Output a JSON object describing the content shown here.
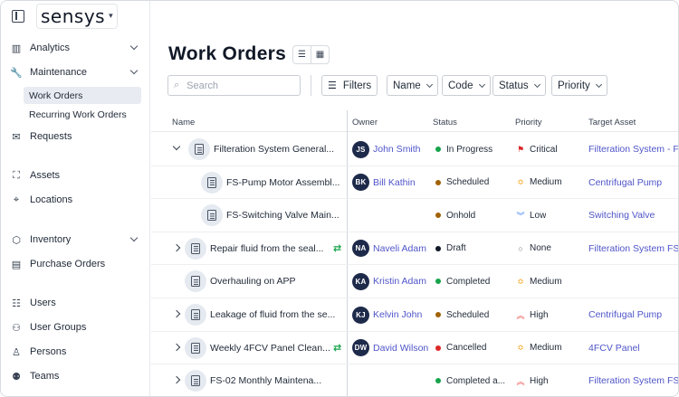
{
  "brand": {
    "name": "sensys"
  },
  "sidebar": {
    "items": [
      {
        "id": "analytics",
        "label": "Analytics",
        "icon": "bar-chart-icon",
        "expandable": true
      },
      {
        "id": "maintenance",
        "label": "Maintenance",
        "icon": "wrench-icon",
        "expandable": true
      },
      {
        "id": "requests",
        "label": "Requests",
        "icon": "inbox-icon"
      },
      {
        "id": "assets",
        "label": "Assets",
        "icon": "frame-icon"
      },
      {
        "id": "locations",
        "label": "Locations",
        "icon": "map-pin-icon"
      },
      {
        "id": "inventory",
        "label": "Inventory",
        "icon": "box-icon",
        "expandable": true
      },
      {
        "id": "purchase-orders",
        "label": "Purchase Orders",
        "icon": "document-icon"
      },
      {
        "id": "users",
        "label": "Users",
        "icon": "user-list-icon"
      },
      {
        "id": "user-groups",
        "label": "User Groups",
        "icon": "users-icon"
      },
      {
        "id": "persons",
        "label": "Persons",
        "icon": "person-icon"
      },
      {
        "id": "teams",
        "label": "Teams",
        "icon": "team-icon"
      }
    ],
    "maintenance_sub": [
      {
        "label": "Work Orders",
        "active": true
      },
      {
        "label": "Recurring Work Orders",
        "active": false
      }
    ]
  },
  "page": {
    "title": "Work Orders"
  },
  "toolbar": {
    "search_placeholder": "Search",
    "filters_label": "Filters",
    "name_label": "Name",
    "code_label": "Code",
    "status_label": "Status",
    "priority_label": "Priority"
  },
  "table": {
    "columns": [
      "Name",
      "Owner",
      "Status",
      "Priority",
      "Target Asset"
    ],
    "rows": [
      {
        "level": 0,
        "expander": "open",
        "name": "Filteration System General...",
        "recurring": false,
        "owner_initials": "JS",
        "owner": "John Smith",
        "status": "In Progress",
        "status_color": "#16a34a",
        "priority": "Critical",
        "priority_icon": "flag-icon",
        "priority_color": "#dc2626",
        "asset": "Filteration System - F"
      },
      {
        "level": 1,
        "expander": "none",
        "name": "FS-Pump Motor Assembl...",
        "recurring": false,
        "owner_initials": "BK",
        "owner": "Bill Kathin",
        "status": "Scheduled",
        "status_color": "#a16207",
        "priority": "Medium",
        "priority_icon": "chevrons-medium-icon",
        "priority_color": "#f59e0b",
        "asset": "Centrifugal Pump"
      },
      {
        "level": 1,
        "expander": "none",
        "name": "FS-Switching Valve Main...",
        "recurring": false,
        "owner_initials": "",
        "owner": "",
        "status": "Onhold",
        "status_color": "#a16207",
        "priority": "Low",
        "priority_icon": "chevrons-down-icon",
        "priority_color": "#3b82f6",
        "asset": "Switching Valve"
      },
      {
        "level": 0,
        "expander": "closed",
        "name": "Repair fluid from the seal...",
        "recurring": true,
        "owner_initials": "NA",
        "owner": "Naveli Adam",
        "status": "Draft",
        "status_color": "#111827",
        "priority": "None",
        "priority_icon": "circle-icon",
        "priority_color": "#6b7280",
        "asset": "Filteration System FS"
      },
      {
        "level": 0,
        "expander": "none",
        "name": "Overhauling on APP",
        "recurring": false,
        "owner_initials": "KA",
        "owner": "Kristin Adam",
        "status": "Completed",
        "status_color": "#16a34a",
        "priority": "Medium",
        "priority_icon": "chevrons-medium-icon",
        "priority_color": "#f59e0b",
        "asset": ""
      },
      {
        "level": 0,
        "expander": "closed",
        "name": "Leakage of fluid from the se...",
        "recurring": false,
        "owner_initials": "KJ",
        "owner": "Kelvin John",
        "status": "Scheduled",
        "status_color": "#a16207",
        "priority": "High",
        "priority_icon": "chevrons-up-icon",
        "priority_color": "#ef4444",
        "asset": "Centrifugal Pump"
      },
      {
        "level": 0,
        "expander": "closed",
        "name": "Weekly 4FCV Panel Clean...",
        "recurring": true,
        "owner_initials": "DW",
        "owner": "David Wilson",
        "status": "Cancelled",
        "status_color": "#dc2626",
        "priority": "Medium",
        "priority_icon": "chevrons-medium-icon",
        "priority_color": "#f59e0b",
        "asset": "4FCV Panel"
      },
      {
        "level": 0,
        "expander": "closed",
        "name": "FS-02 Monthly Maintena...",
        "recurring": false,
        "owner_initials": "",
        "owner": "",
        "status": "Completed a...",
        "status_color": "#16a34a",
        "priority": "High",
        "priority_icon": "chevrons-up-icon",
        "priority_color": "#ef4444",
        "asset": "Filteration System FS"
      }
    ]
  }
}
